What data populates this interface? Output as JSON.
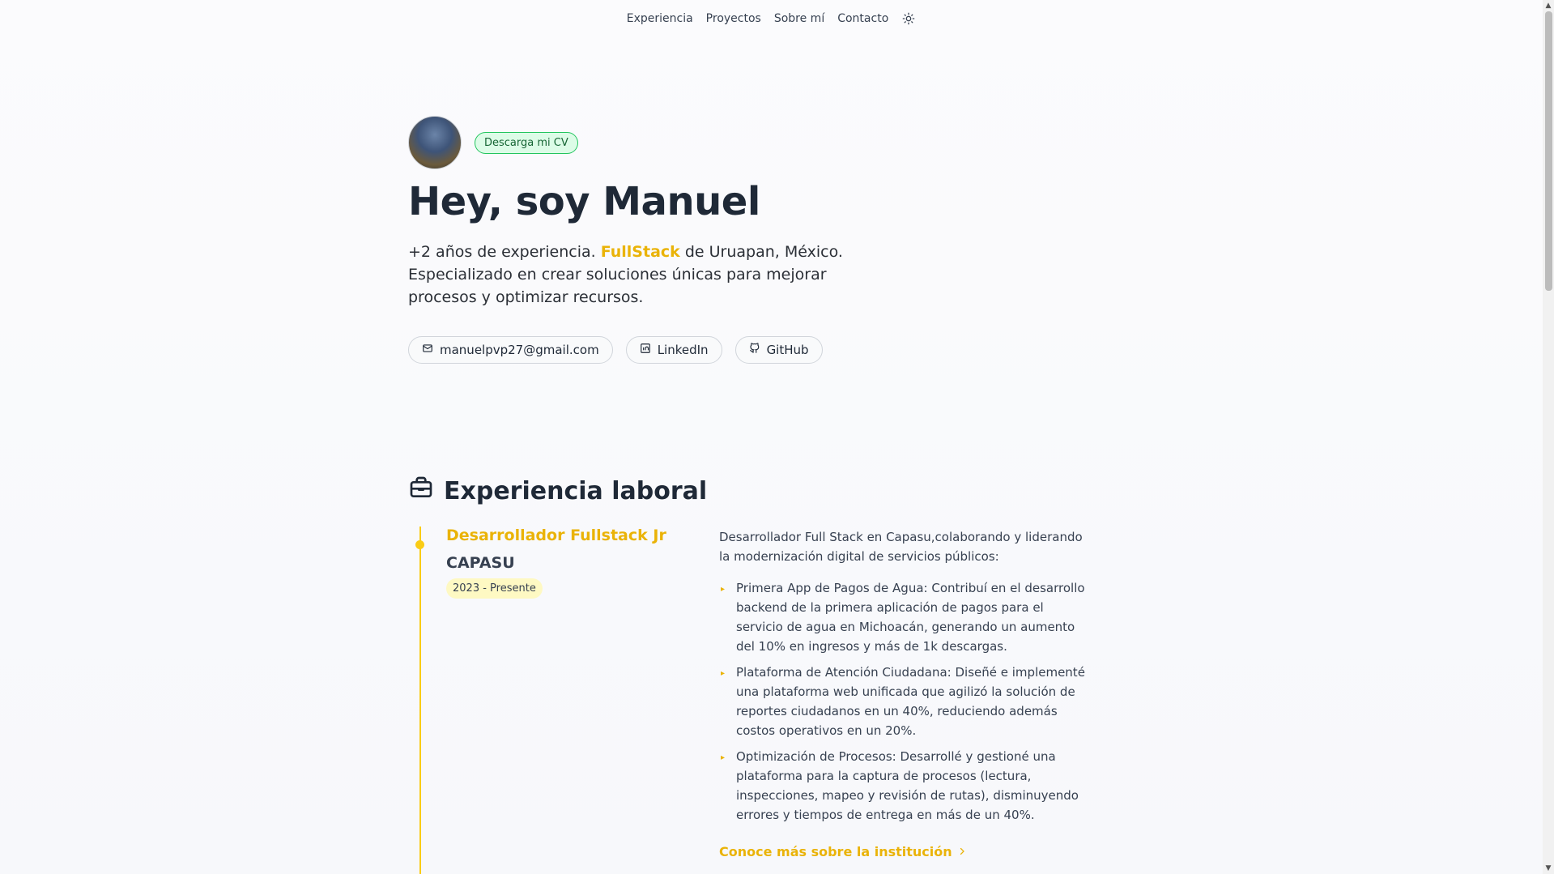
{
  "nav": {
    "items": [
      "Experiencia",
      "Proyectos",
      "Sobre mí",
      "Contacto"
    ],
    "theme_icon": "sun-icon"
  },
  "hero": {
    "cv_label": "Descarga mi CV",
    "title": "Hey, soy Manuel",
    "intro_before": "+2 años de experiencia.",
    "intro_accent": "FullStack",
    "intro_after": "de Uruapan, México. Especializado en crear soluciones únicas para mejorar procesos y optimizar recursos.",
    "links": {
      "email": "manuelpvp27@gmail.com",
      "linkedin": "LinkedIn",
      "github": "GitHub"
    }
  },
  "experience": {
    "section_title": "Experiencia laboral",
    "jobs": [
      {
        "role": "Desarrollador Fullstack Jr",
        "company": "CAPASU",
        "date": "2023 - Presente",
        "summary": "Desarrollador Full Stack en Capasu,colaborando y liderando la modernización digital de servicios públicos:",
        "bullets": [
          "Primera App de Pagos de Agua: Contribuí en el desarrollo backend de la primera aplicación de pagos para el servicio de agua en Michoacán, generando un aumento del 10% en ingresos y más de 1k descargas.",
          "Plataforma de Atención Ciudadana: Diseñé e implementé una plataforma web unificada que agilizó la solución de reportes ciudadanos en un 40%, reduciendo además costos operativos en un 20%.",
          "Optimización de Procesos: Desarrollé y gestioné una plataforma para la captura de procesos (lectura, inspecciones, mapeo y revisión de rutas), disminuyendo errores y tiempos de entrega en más de un 40%."
        ],
        "more_link": "Conoce más sobre la institución"
      }
    ]
  },
  "colors": {
    "accent": "#eab308",
    "badge_green": "#22c55e"
  }
}
